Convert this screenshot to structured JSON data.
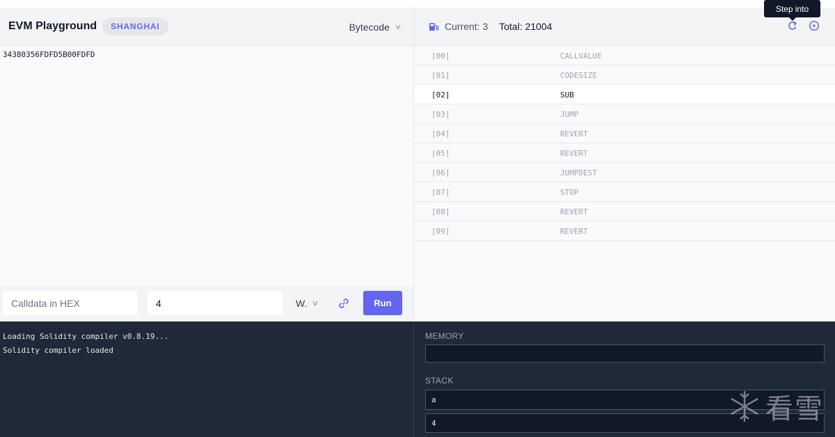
{
  "header": {
    "app_title": "EVM Playground",
    "fork": "SHANGHAI",
    "mode": "Bytecode"
  },
  "gas": {
    "current": "Current: 3",
    "total": "Total: 21004"
  },
  "toolbar": {
    "tooltip": "Step into"
  },
  "editor": {
    "code": "34380356FDFD5B00FDFD"
  },
  "calldata": {
    "placeholder": "Calldata in HEX",
    "value_input": "4",
    "unit": "W.",
    "run_label": "Run"
  },
  "opcodes": [
    {
      "pc": "[00]",
      "name": "CALLVALUE"
    },
    {
      "pc": "[01]",
      "name": "CODESIZE"
    },
    {
      "pc": "[02]",
      "name": "SUB"
    },
    {
      "pc": "[03]",
      "name": "JUMP"
    },
    {
      "pc": "[04]",
      "name": "REVERT"
    },
    {
      "pc": "[05]",
      "name": "REVERT"
    },
    {
      "pc": "[06]",
      "name": "JUMPDEST"
    },
    {
      "pc": "[07]",
      "name": "STOP"
    },
    {
      "pc": "[08]",
      "name": "REVERT"
    },
    {
      "pc": "[09]",
      "name": "REVERT"
    }
  ],
  "console": {
    "lines": [
      "Loading Solidity compiler v0.8.19...",
      "Solidity compiler loaded"
    ]
  },
  "state": {
    "memory_label": "MEMORY",
    "memory_value": "",
    "stack_label": "STACK",
    "stack": [
      "a",
      "4"
    ]
  },
  "watermark": {
    "text": "看雪"
  },
  "colors": {
    "accent": "#6366f1",
    "console_bg": "#1f2937"
  },
  "icons": {
    "gas": "gas-pump-icon",
    "step_into": "step-into-icon",
    "run_all": "play-circle-icon",
    "link": "link-icon"
  }
}
